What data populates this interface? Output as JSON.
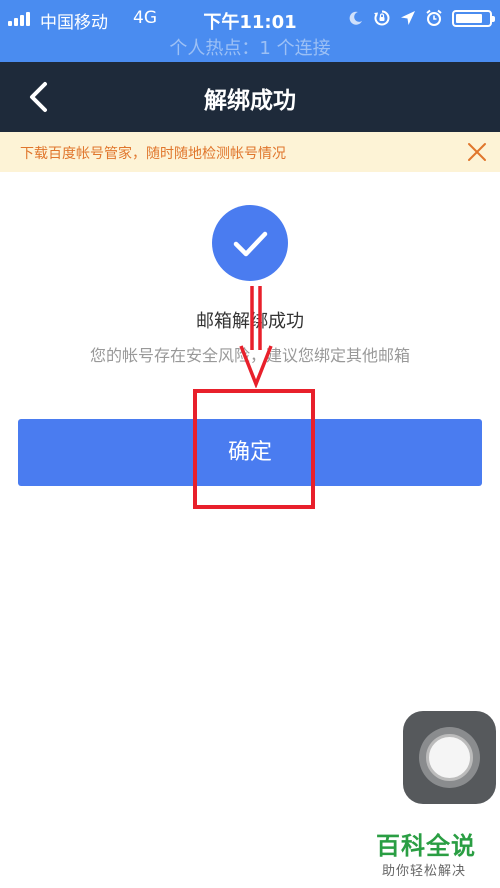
{
  "status_bar": {
    "carrier": "中国移动",
    "network": "4G",
    "time": "下午11:01",
    "hotspot": "个人热点：1 个连接",
    "icons": [
      "moon-icon",
      "rotation-lock-icon",
      "location-icon",
      "alarm-icon",
      "battery-icon"
    ],
    "battery_level": 0.8
  },
  "nav": {
    "back_icon": "chevron-left-icon",
    "title": "解绑成功"
  },
  "banner": {
    "text": "下载百度帐号管家，随时随地检测帐号情况",
    "close_icon": "close-icon"
  },
  "result": {
    "icon": "check-icon",
    "title": "邮箱解绑成功",
    "description": "您的帐号存在安全风险，建议您绑定其他邮箱"
  },
  "confirm_button": {
    "label": "确定"
  },
  "watermark": {
    "title": "百科全说",
    "subtitle": "助你轻松解决"
  },
  "colors": {
    "status_bar": "#4a8cf0",
    "nav_bar": "#1e2a3a",
    "accent": "#4a7cf0",
    "banner_bg": "#fdf3d6",
    "banner_text": "#e0762c",
    "annotation": "#e8202b",
    "watermark": "#2a9e43"
  }
}
